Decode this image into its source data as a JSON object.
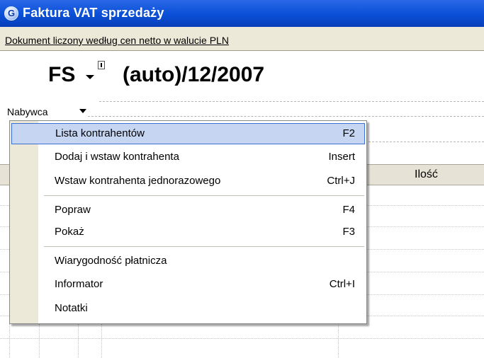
{
  "window": {
    "title": "Faktura VAT sprzedaży",
    "icon": "app-logo-icon"
  },
  "infobar": {
    "text": "Dokument liczony według cen netto w walucie PLN"
  },
  "document": {
    "prefix": "FS",
    "rest": "(auto)/12/2007"
  },
  "nabywca": {
    "label": "Nabywca"
  },
  "grid": {
    "ilosc_header": "Ilość"
  },
  "menu": {
    "items": [
      {
        "label": "Lista kontrahentów",
        "shortcut": "F2",
        "highlighted": true
      },
      {
        "label": "Dodaj i wstaw kontrahenta",
        "shortcut": "Insert"
      },
      {
        "label": "Wstaw kontrahenta jednorazowego",
        "shortcut": "Ctrl+J"
      },
      {
        "label": "Popraw",
        "shortcut": "F4"
      },
      {
        "label": "Pokaż",
        "shortcut": "F3"
      },
      {
        "label": "Wiarygodność płatnicza",
        "shortcut": ""
      },
      {
        "label": "Informator",
        "shortcut": "Ctrl+I"
      },
      {
        "label": "Notatki",
        "shortcut": ""
      }
    ]
  }
}
